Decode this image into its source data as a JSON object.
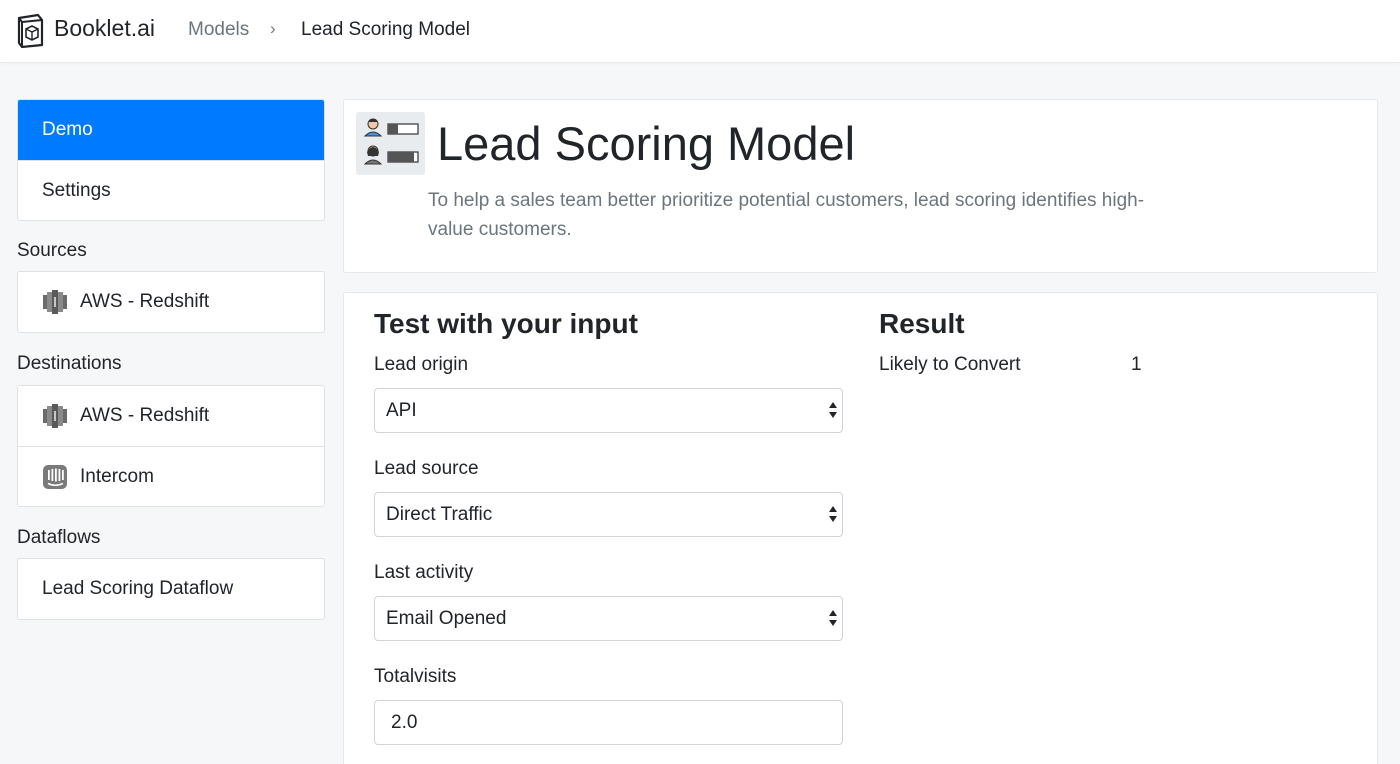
{
  "topbar": {
    "brand_icon": "cube-box-icon",
    "brand_name": "Booklet.ai",
    "breadcrumb": {
      "parent": "Models",
      "separator": "›",
      "current": "Lead Scoring Model"
    }
  },
  "sidebar": {
    "nav": [
      {
        "label": "Demo",
        "active": true
      },
      {
        "label": "Settings",
        "active": false
      }
    ],
    "sources_heading": "Sources",
    "sources": [
      {
        "label": "AWS - Redshift",
        "icon": "redshift-icon"
      }
    ],
    "destinations_heading": "Destinations",
    "destinations": [
      {
        "label": "AWS - Redshift",
        "icon": "redshift-icon"
      },
      {
        "label": "Intercom",
        "icon": "intercom-icon"
      }
    ],
    "dataflows_heading": "Dataflows",
    "dataflows": [
      {
        "label": "Lead Scoring Dataflow"
      }
    ]
  },
  "model": {
    "icon": "lead-scoring-icon",
    "title": "Lead Scoring Model",
    "description": "To help a sales team better prioritize potential customers, lead scoring identifies high-value customers."
  },
  "form": {
    "heading": "Test with your input",
    "fields": [
      {
        "label": "Lead origin",
        "type": "select",
        "value": "API"
      },
      {
        "label": "Lead source",
        "type": "select",
        "value": "Direct Traffic"
      },
      {
        "label": "Last activity",
        "type": "select",
        "value": "Email Opened"
      },
      {
        "label": "Totalvisits",
        "type": "text",
        "value": "2.0"
      }
    ]
  },
  "result": {
    "heading": "Result",
    "rows": [
      {
        "label": "Likely to Convert",
        "value": "1"
      }
    ]
  },
  "colors": {
    "accent": "#007bff",
    "background": "#f6f7f9",
    "muted_text": "#6c757d"
  }
}
